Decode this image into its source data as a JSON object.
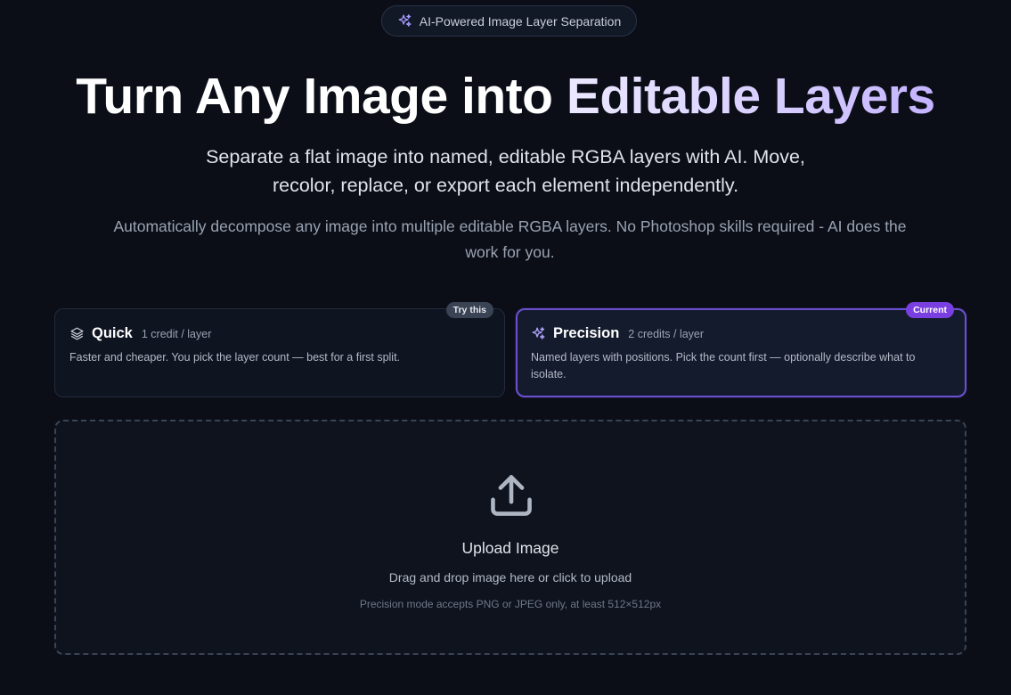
{
  "badge": {
    "text": "AI-Powered Image Layer Separation",
    "icon": "sparkles-icon"
  },
  "hero": {
    "title_plain": "Turn Any Image into",
    "title_highlight": "Editable Layers",
    "subtitle": "Separate a flat image into named, editable RGBA layers with AI. Move, recolor, replace, or export each element independently.",
    "description": "Automatically decompose any image into multiple editable RGBA layers. No Photoshop skills required - AI does the work for you."
  },
  "modes": [
    {
      "name": "Quick",
      "cost": "1 credit / layer",
      "description": "Faster and cheaper. You pick the layer count — best for a first split.",
      "badge": "Try this",
      "icon": "layers-icon",
      "selected": false
    },
    {
      "name": "Precision",
      "cost": "2 credits / layer",
      "description": "Named layers with positions. Pick the count first — optionally describe what to isolate.",
      "badge": "Current",
      "icon": "sparkles-icon",
      "selected": true
    }
  ],
  "upload": {
    "title": "Upload Image",
    "subtitle": "Drag and drop image here or click to upload",
    "note": "Precision mode accepts PNG or JPEG only, at least 512×512px",
    "icon": "upload-icon"
  },
  "colors": {
    "background": "#0b0e17",
    "accent": "#7a3fe0",
    "selected_border": "#6b4fd1"
  }
}
